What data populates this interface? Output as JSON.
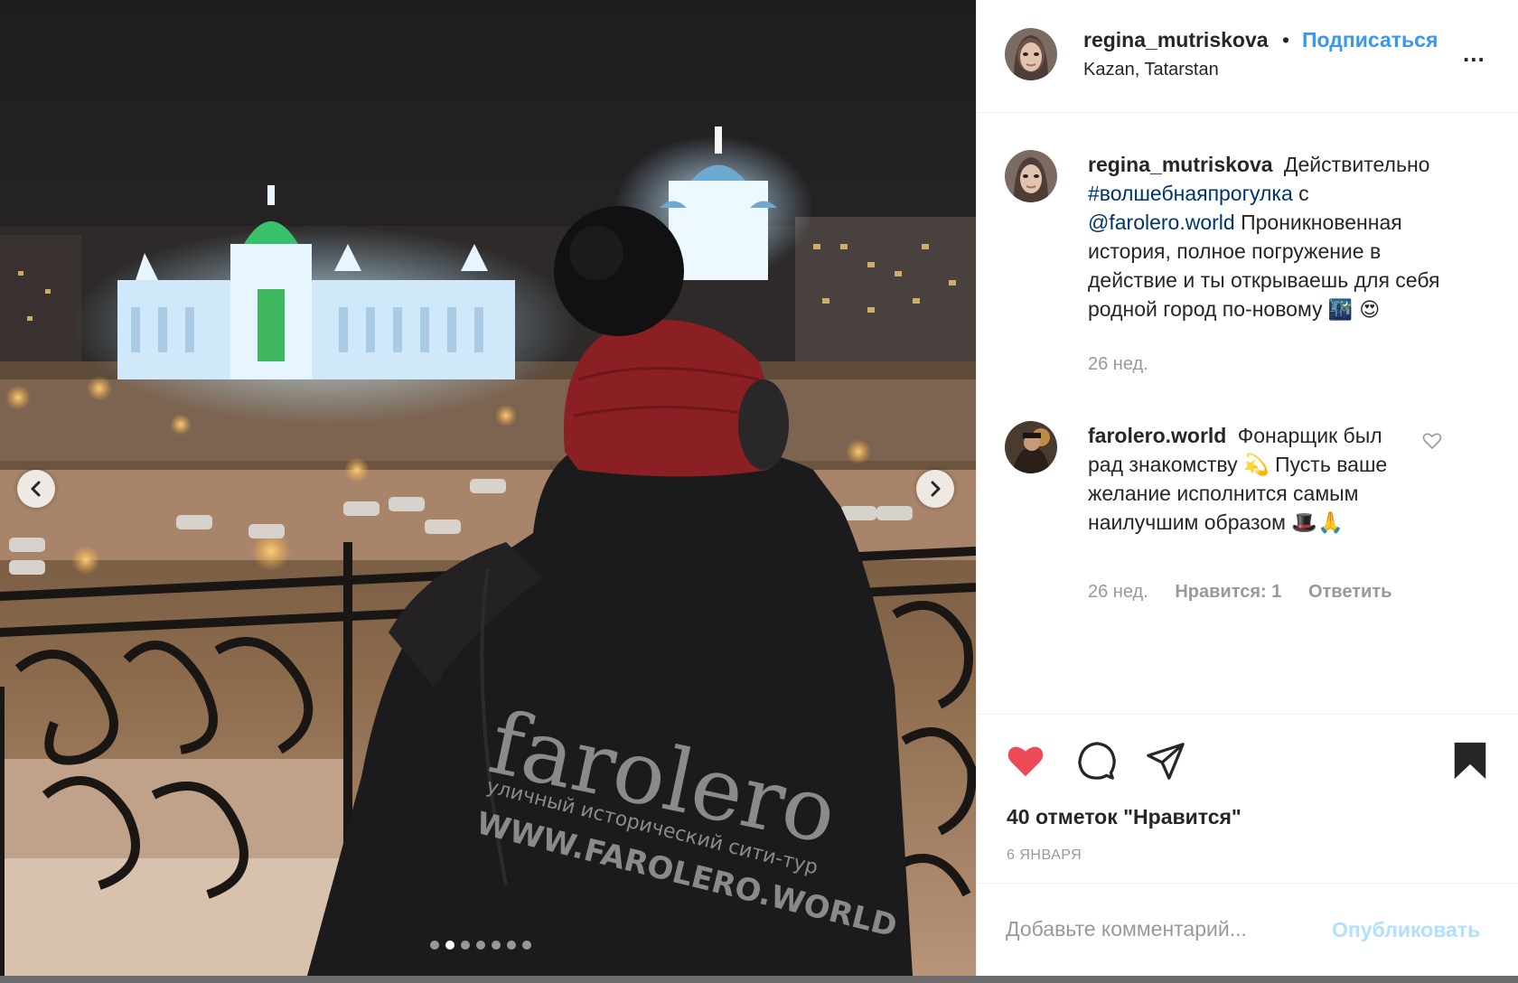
{
  "media": {
    "prev_icon": "chevron-left-icon",
    "next_icon": "chevron-right-icon",
    "carousel": {
      "count": 7,
      "active_index": 1
    },
    "jacket_text": {
      "brand": "farolero",
      "line1": "уличный исторический сити-тур",
      "line2": "WWW.FAROLERO.WORLD"
    }
  },
  "header": {
    "username": "regina_mutriskova",
    "bullet": "•",
    "follow_label": "Подписаться",
    "location": "Kazan, Tatarstan",
    "more_label": "..."
  },
  "caption": {
    "username": "regina_mutriskova",
    "text_1": "Действительно",
    "hashtag": "#волшебнаяпрогулка",
    "text_2": "с",
    "mention": "@farolero.world",
    "text_3": "Проникновенная история, полное погружение в действие и ты открываешь для себя родной город по-новому",
    "emoji": "🌃 😍",
    "time": "26 нед."
  },
  "reply": {
    "username": "farolero.world",
    "text": "Фонарщик был рад знакомству 💫 Пусть ваше желание исполнится самым наилучшим образом 🎩🙏",
    "time": "26 нед.",
    "likes": "Нравится: 1",
    "reply_label": "Ответить"
  },
  "actions": {
    "like_icon": "heart-filled-icon",
    "comment_icon": "comment-icon",
    "share_icon": "paper-plane-icon",
    "save_icon": "bookmark-icon",
    "likes_text": "40 отметок \"Нравится\"",
    "date": "6 ЯНВАРЯ"
  },
  "composer": {
    "placeholder": "Добавьте комментарий...",
    "publish_label": "Опубликовать"
  },
  "colors": {
    "accent": "#3897f0",
    "like_red": "#ed4956",
    "link": "#003569",
    "muted": "#999999",
    "text": "#262626"
  }
}
